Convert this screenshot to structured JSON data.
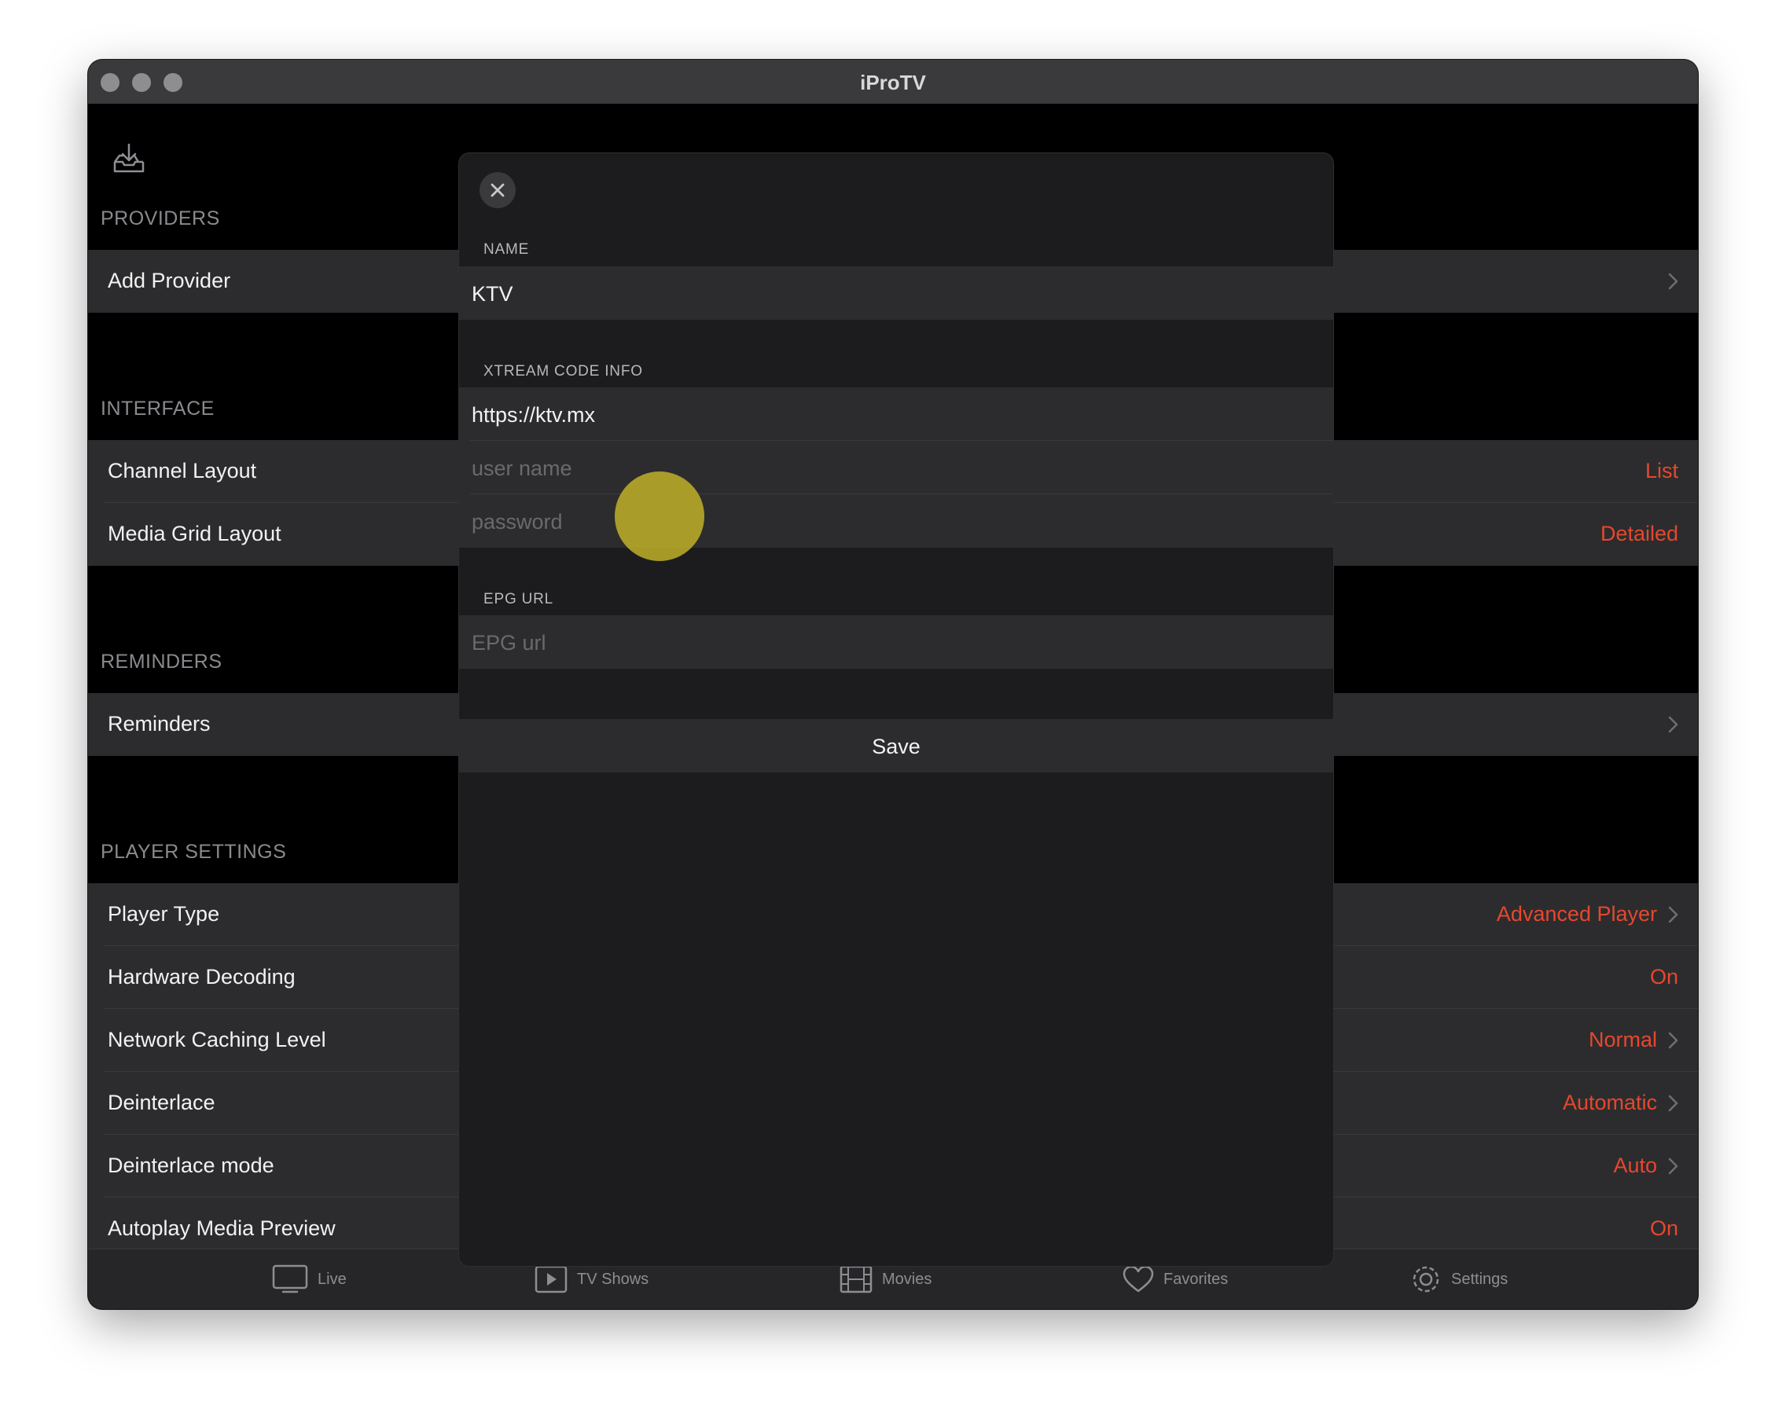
{
  "window": {
    "title": "iProTV"
  },
  "sections": {
    "providers": {
      "header": "PROVIDERS",
      "add_provider": "Add Provider"
    },
    "interface": {
      "header": "INTERFACE",
      "rows": [
        {
          "label": "Channel Layout",
          "value": "List"
        },
        {
          "label": "Media Grid Layout",
          "value": "Detailed"
        }
      ]
    },
    "reminders": {
      "header": "REMINDERS",
      "row_label": "Reminders"
    },
    "player_settings": {
      "header": "PLAYER SETTINGS",
      "rows": [
        {
          "label": "Player Type",
          "value": "Advanced Player"
        },
        {
          "label": "Hardware Decoding",
          "value": "On"
        },
        {
          "label": "Network Caching Level",
          "value": "Normal"
        },
        {
          "label": "Deinterlace",
          "value": "Automatic"
        },
        {
          "label": "Deinterlace mode",
          "value": "Auto"
        },
        {
          "label": "Autoplay Media Preview",
          "value": "On"
        }
      ]
    }
  },
  "tabbar": {
    "items": [
      {
        "label": "Live",
        "icon": "tv-icon"
      },
      {
        "label": "TV Shows",
        "icon": "play-icon"
      },
      {
        "label": "Movies",
        "icon": "film-icon"
      },
      {
        "label": "Favorites",
        "icon": "heart-icon"
      },
      {
        "label": "Settings",
        "icon": "gear-icon"
      }
    ]
  },
  "modal": {
    "name_header": "NAME",
    "name_value": "KTV",
    "xtream_header": "XTREAM CODE INFO",
    "url_value": "https://ktv.mx",
    "username_placeholder": "user name",
    "password_placeholder": "password",
    "epg_header": "EPG URL",
    "epg_placeholder": "EPG url",
    "save_label": "Save"
  },
  "colors": {
    "accent": "#e5482e",
    "background": "#000000",
    "row": "#2c2c2e",
    "modal": "#1c1c1e"
  }
}
